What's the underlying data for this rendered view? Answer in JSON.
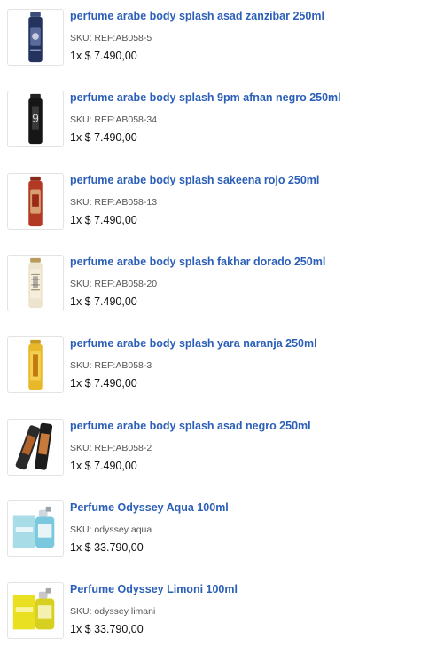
{
  "items": [
    {
      "title": "perfume arabe body splash asad zanzibar 250ml",
      "sku": "SKU: REF:AB058-5",
      "price": "1x $ 7.490,00",
      "thumb_icon": "perfume-can-navy-icon"
    },
    {
      "title": "perfume arabe body splash 9pm afnan negro 250ml",
      "sku": "SKU: REF:AB058-34",
      "price": "1x $ 7.490,00",
      "thumb_icon": "perfume-can-black-icon"
    },
    {
      "title": "perfume arabe body splash sakeena rojo 250ml",
      "sku": "SKU: REF:AB058-13",
      "price": "1x $ 7.490,00",
      "thumb_icon": "perfume-can-red-icon"
    },
    {
      "title": "perfume arabe body splash fakhar dorado 250ml",
      "sku": "SKU: REF:AB058-20",
      "price": "1x $ 7.490,00",
      "thumb_icon": "perfume-can-cream-icon"
    },
    {
      "title": "perfume arabe body splash yara naranja 250ml",
      "sku": "SKU: REF:AB058-3",
      "price": "1x $ 7.490,00",
      "thumb_icon": "perfume-can-gold-icon"
    },
    {
      "title": "perfume arabe body splash asad negro 250ml",
      "sku": "SKU: REF:AB058-2",
      "price": "1x $ 7.490,00",
      "thumb_icon": "perfume-cans-dark-icon"
    },
    {
      "title": "Perfume Odyssey Aqua 100ml",
      "sku": "SKU: odyssey aqua",
      "price": "1x $ 33.790,00",
      "thumb_icon": "perfume-bottle-aqua-icon"
    },
    {
      "title": "Perfume Odyssey Limoni 100ml",
      "sku": "SKU: odyssey limani",
      "price": "1x $ 33.790,00",
      "thumb_icon": "perfume-bottle-limoni-icon"
    }
  ]
}
